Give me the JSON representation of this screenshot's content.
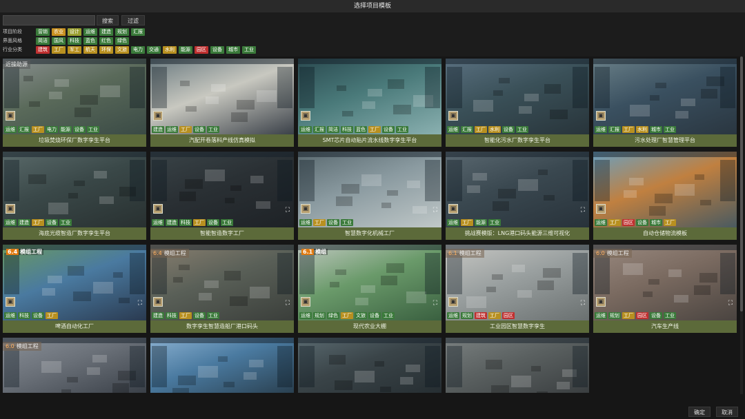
{
  "window": {
    "title": "选择项目模板"
  },
  "toolbar": {
    "search_value": "",
    "search_label": "搜索",
    "filter_label": "过滤"
  },
  "filters": [
    {
      "label": "项目阶段",
      "tags": [
        {
          "text": "营销",
          "color": "#3a7a3a"
        },
        {
          "text": "农业",
          "color": "#c89020"
        },
        {
          "text": "设计",
          "color": "#9aa030"
        },
        {
          "text": "运维",
          "color": "#3a7a3a"
        },
        {
          "text": "建造",
          "color": "#3a7a3a"
        },
        {
          "text": "规划",
          "color": "#3a7a3a"
        },
        {
          "text": "汇报",
          "color": "#3a7a3a"
        }
      ]
    },
    {
      "label": "界面风格",
      "tags": [
        {
          "text": "简洁",
          "color": "#3a7a3a"
        },
        {
          "text": "国风",
          "color": "#3a7a3a"
        },
        {
          "text": "科技",
          "color": "#3a7a3a"
        },
        {
          "text": "蓝色",
          "color": "#3a7a3a"
        },
        {
          "text": "红色",
          "color": "#3a7a3a"
        },
        {
          "text": "绿色",
          "color": "#3a7a3a"
        }
      ]
    },
    {
      "label": "行业分类",
      "tags": [
        {
          "text": "建筑",
          "color": "#c03030"
        },
        {
          "text": "工厂",
          "color": "#b89020"
        },
        {
          "text": "军工",
          "color": "#b89020"
        },
        {
          "text": "航天",
          "color": "#b89020"
        },
        {
          "text": "环保",
          "color": "#b89020"
        },
        {
          "text": "文旅",
          "color": "#b89020"
        },
        {
          "text": "电力",
          "color": "#3a7a3a"
        },
        {
          "text": "交通",
          "color": "#3a7a3a"
        },
        {
          "text": "水利",
          "color": "#b89020"
        },
        {
          "text": "能源",
          "color": "#3a7a3a"
        },
        {
          "text": "园区",
          "color": "#c03030"
        },
        {
          "text": "设备",
          "color": "#3a7a3a"
        },
        {
          "text": "城市",
          "color": "#3a7a3a"
        },
        {
          "text": "工业",
          "color": "#3a7a3a"
        }
      ]
    }
  ],
  "tag_colors": {
    "运维": "#3a7a3a",
    "汇报": "#3a7a3a",
    "工厂": "#b89020",
    "电力": "#3a7a3a",
    "能源": "#3a7a3a",
    "设备": "#3a7a3a",
    "工业": "#3a7a3a",
    "建造": "#3a7a3a",
    "简洁": "#3a7a3a",
    "科技": "#3a7a3a",
    "蓝色": "#3a7a3a",
    "水利": "#b89020",
    "城市": "#3a7a3a",
    "园区": "#c03030",
    "规划": "#3a7a3a",
    "绿色": "#3a7a3a",
    "建筑": "#c03030"
  },
  "templates": [
    {
      "title": "垃圾焚烧环保厂数字孪生平台",
      "tags": [
        "运维",
        "汇报",
        "工厂",
        "电力",
        "能源",
        "设备",
        "工业"
      ],
      "overlay": "近操助源",
      "palette": [
        "#5a6a5a",
        "#8a9090",
        "#3a4a45"
      ],
      "expand": false
    },
    {
      "title": "汽配开卷落料产线仿真模拟",
      "tags": [
        "建造",
        "运维",
        "工厂",
        "设备",
        "工业"
      ],
      "overlay": "",
      "palette": [
        "#c8c8c0",
        "#6a7a80",
        "#3a4048"
      ],
      "expand": false
    },
    {
      "title": "SMT芯片自动贴片流水线数字孪生平台",
      "tags": [
        "运维",
        "汇报",
        "简洁",
        "科技",
        "蓝色",
        "工厂",
        "设备",
        "工业"
      ],
      "overlay": "",
      "palette": [
        "#4a7a7a",
        "#2a4a50",
        "#8ab0b0"
      ],
      "expand": false
    },
    {
      "title": "智能化污水厂数字孪生平台",
      "tags": [
        "运维",
        "汇报",
        "工厂",
        "水利",
        "设备",
        "工业"
      ],
      "overlay": "",
      "palette": [
        "#3a5058",
        "#5a7080",
        "#28343a"
      ],
      "expand": false
    },
    {
      "title": "污水处理厂智慧管理平台",
      "tags": [
        "运维",
        "汇报",
        "工厂",
        "水利",
        "城市",
        "工业"
      ],
      "overlay": "",
      "palette": [
        "#3a5060",
        "#6a8088",
        "#2a3640"
      ],
      "expand": false
    },
    {
      "title": "海底光缆智造厂数字孪生平台",
      "tags": [
        "运维",
        "建造",
        "工厂",
        "设备",
        "工业"
      ],
      "overlay": "",
      "palette": [
        "#3a4848",
        "#5a6a6a",
        "#283030"
      ],
      "expand": false
    },
    {
      "title": "智能智造数字工厂",
      "tags": [
        "运维",
        "建造",
        "科技",
        "工厂",
        "设备",
        "工业"
      ],
      "overlay": "",
      "palette": [
        "#2a3034",
        "#3a4448",
        "#1e2226"
      ],
      "expand": true
    },
    {
      "title": "智慧数字化机械工厂",
      "tags": [
        "运维",
        "工厂",
        "设备",
        "工业"
      ],
      "overlay": "",
      "palette": [
        "#8a9aa0",
        "#5a6a70",
        "#c0c8c8"
      ],
      "expand": true
    },
    {
      "title": "挑战赛模版：LNG港口码头能源三维可视化",
      "tags": [
        "运维",
        "工厂",
        "能源",
        "工业"
      ],
      "overlay": "",
      "palette": [
        "#3a4850",
        "#5a6870",
        "#28323a"
      ],
      "expand": true
    },
    {
      "title": "自动仓储物流模板",
      "tags": [
        "运维",
        "工厂",
        "园区",
        "设备",
        "城市",
        "工厂"
      ],
      "overlay": "",
      "palette": [
        "#c08040",
        "#6aa0c0",
        "#4a5a60"
      ],
      "expand": false
    },
    {
      "title": "啤酒自动化工厂",
      "tags": [
        "运维",
        "科技",
        "设备",
        "工厂"
      ],
      "overlay": "",
      "badge": {
        "num": "6.4",
        "text": "模组工程"
      },
      "palette": [
        "#4a7aa0",
        "#6a9a60",
        "#2a3a50"
      ],
      "expand": true
    },
    {
      "title": "数字孪生智慧造船厂港口码头",
      "tags": [
        "建造",
        "科技",
        "工厂",
        "设备",
        "工业"
      ],
      "overlay": "",
      "ribbon": {
        "num": "6.4",
        "text": "模组工程"
      },
      "palette": [
        "#5a6058",
        "#8a8070",
        "#3a3e3a"
      ],
      "expand": true
    },
    {
      "title": "现代农业大棚",
      "tags": [
        "运维",
        "规划",
        "绿色",
        "工厂",
        "文旅",
        "设备",
        "工业"
      ],
      "overlay": "",
      "badge": {
        "num": "6.1",
        "text": "模组"
      },
      "palette": [
        "#6a9a6a",
        "#c0c8c0",
        "#3a6040"
      ],
      "expand": true
    },
    {
      "title": "工业园区智慧数字孪生",
      "tags": [
        "运维",
        "规划",
        "建筑",
        "工厂",
        "园区"
      ],
      "overlay": "",
      "ribbon": {
        "num": "6.1",
        "text": "模组工程"
      },
      "palette": [
        "#9aa0a0",
        "#c8c8c4",
        "#6a7070"
      ],
      "expand": true
    },
    {
      "title": "汽车生产线",
      "tags": [
        "运维",
        "规划",
        "工厂",
        "园区",
        "设备",
        "工业"
      ],
      "overlay": "",
      "ribbon": {
        "num": "6.0",
        "text": "模组工程"
      },
      "palette": [
        "#7a6a60",
        "#9a8a80",
        "#4a4440"
      ],
      "expand": true
    },
    {
      "title": "",
      "tags": [],
      "overlay": "",
      "ribbon": {
        "num": "6.0",
        "text": "模组工程"
      },
      "palette": [
        "#6a7078",
        "#8a9098",
        "#3a4048"
      ],
      "expand": false
    },
    {
      "title": "",
      "tags": [],
      "overlay": "",
      "palette": [
        "#4a7aa0",
        "#8ab0d0",
        "#2a4050"
      ],
      "expand": false
    },
    {
      "title": "",
      "tags": [],
      "overlay": "",
      "palette": [
        "#3a4448",
        "#5a6a70",
        "#262e32"
      ],
      "expand": false
    },
    {
      "title": "",
      "tags": [],
      "overlay": "",
      "palette": [
        "#5a6060",
        "#7a8080",
        "#3a3e40"
      ],
      "expand": false
    }
  ],
  "footer": {
    "ok_label": "确定",
    "cancel_label": "取消"
  }
}
